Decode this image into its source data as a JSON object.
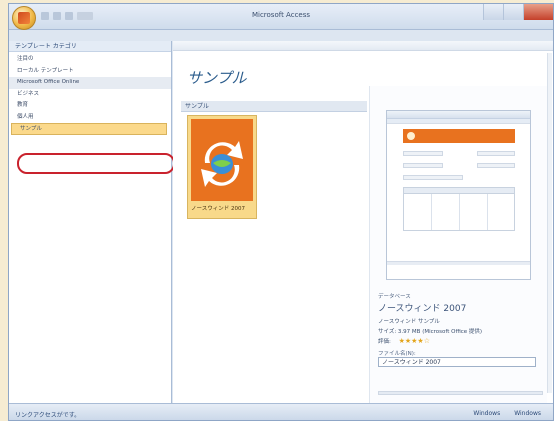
{
  "window": {
    "title": "Microsoft Access",
    "colors": {
      "accent": "#e8721f",
      "selection": "#fbd98b",
      "highlight_ring": "#c9222d"
    }
  },
  "quick_access": {
    "icons": [
      "save-icon",
      "undo-icon",
      "redo-icon",
      "customize-icon"
    ]
  },
  "sidebar": {
    "header": "テンプレート カテゴリ",
    "items": [
      {
        "label": "注目の"
      },
      {
        "label": "ローカル テンプレート"
      },
      {
        "label": "Microsoft Office Online"
      },
      {
        "label": "ビジネス"
      },
      {
        "label": "教育"
      },
      {
        "label": "個人用"
      },
      {
        "label": "サンプル"
      }
    ]
  },
  "main": {
    "title": "サンプル",
    "section": "サンプル",
    "tile_label": "ノースウィンド 2007"
  },
  "detail": {
    "provider_label": "データベース",
    "name": "ノースウィンド 2007",
    "description": "ノースウィンド サンプル",
    "size": "サイズ: 3.97 MB (Microsoft Office 提供)",
    "rating_label": "評価:",
    "rating": 4,
    "filename_label": "ファイル名(N):",
    "filename_value": "ノースウィンド 2007"
  },
  "status": {
    "left": "リンクアクセスがです。",
    "right": [
      "Windows",
      "Windows"
    ]
  }
}
